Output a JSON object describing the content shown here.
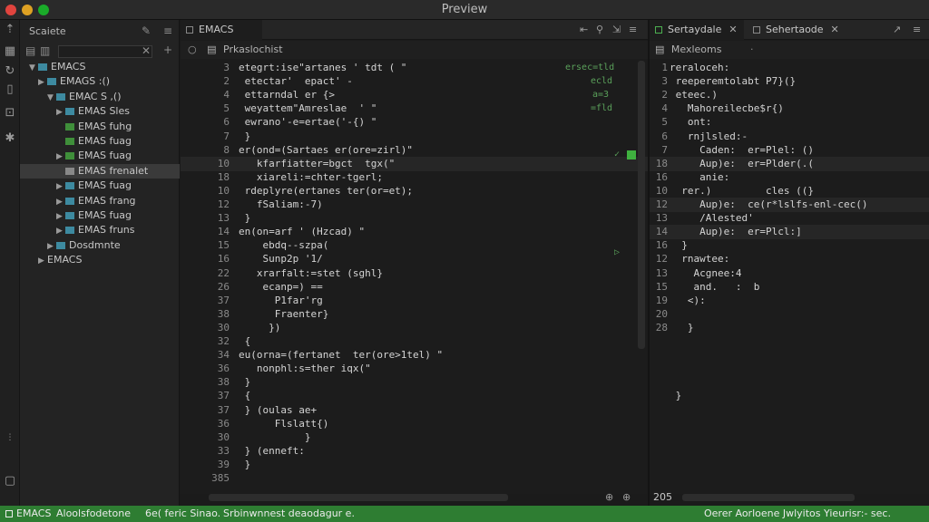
{
  "window": {
    "title": "Preview"
  },
  "colors": {
    "accent": "#2e7d32",
    "background": "#1c1c1c",
    "sidebar": "#232323"
  },
  "activity_icons": [
    "arrow-up-icon",
    "files-icon",
    "refresh-icon",
    "document-icon",
    "debug-icon",
    "settings-icon"
  ],
  "sidebar": {
    "title": "Scaiete",
    "tree": [
      {
        "label": "EMACS",
        "twisty": "▼",
        "icon": "folder",
        "indent": 0
      },
      {
        "label": "EMAGS :()",
        "twisty": "▶",
        "icon": "folder",
        "indent": 1
      },
      {
        "label": "EMAC S ,()",
        "twisty": "▼",
        "icon": "folder",
        "indent": 2
      },
      {
        "label": "EMAS Sles",
        "twisty": "▶",
        "icon": "folder",
        "indent": 3
      },
      {
        "label": "EMAS fuhg",
        "twisty": "",
        "icon": "green",
        "indent": 3
      },
      {
        "label": "EMAS fuag",
        "twisty": "",
        "icon": "green",
        "indent": 3
      },
      {
        "label": "EMAS fuag",
        "twisty": "▶",
        "icon": "green",
        "indent": 3
      },
      {
        "label": "EMAS frenalet",
        "twisty": "",
        "icon": "gray",
        "indent": 3,
        "selected": true
      },
      {
        "label": "EMAS fuag",
        "twisty": "▶",
        "icon": "folder",
        "indent": 3
      },
      {
        "label": "EMAS frang",
        "twisty": "▶",
        "icon": "folder",
        "indent": 3
      },
      {
        "label": "EMAS fuag",
        "twisty": "▶",
        "icon": "folder",
        "indent": 3
      },
      {
        "label": "EMAS fruns",
        "twisty": "▶",
        "icon": "folder",
        "indent": 3
      },
      {
        "label": "Dosdmnte",
        "twisty": "▶",
        "icon": "folder",
        "indent": 2
      },
      {
        "label": "EMACS",
        "twisty": "▶",
        "icon": "",
        "indent": 1
      }
    ]
  },
  "editor_left": {
    "tab_label": "EMACS",
    "breadcrumb": "Prkaslochist",
    "line_numbers": [
      "3",
      "2",
      "4",
      "5",
      "6",
      "7",
      "8",
      "10",
      "18",
      "10",
      "12",
      "13",
      "14",
      "15",
      "16",
      "22",
      "26",
      "37",
      "38",
      "30",
      "32",
      "34",
      "36",
      "38",
      "37",
      "37",
      "36",
      "30",
      "33",
      "39",
      "385"
    ],
    "lines": [
      "etegrt:ise\"artanes ' tdt ( \"",
      " etectar'  epact' -",
      " ettarndal er {>",
      " weyattem\"Amreslae  ' \"",
      " ewrano'-e=ertae('-{) \"",
      " }",
      "er(ond=(Sartaes er(ore=zirl)\"",
      "   kfarfiatter=bgct  tgx(\"",
      "   xiareli:=chter-tgerl;",
      " rdeplyre(ertanes ter(or=et);",
      "   fSaliam:-7)",
      " }",
      "en(on=arf ' (Hzcad) \"",
      "    ebdq--szpa(",
      "    Sunp2p '1/",
      "   xrarfalt:=stet (sghl}",
      "    ecanp=) ==",
      "      P1far'rg",
      "      Fraenter}",
      "     })",
      " {",
      "eu(orna=(fertanet  ter(ore>1tel) \"",
      "   nonphl:s=ther iqx(\"",
      " }",
      " {",
      " } (oulas ae+",
      "      Flslatt{)",
      "           }",
      " } (enneft:",
      " }",
      ""
    ],
    "markers": [
      "ersec=tld",
      "ecld",
      "a=3",
      "=fld"
    ],
    "status_right": "⊕ ⊕"
  },
  "editor_right": {
    "tabs": [
      {
        "label": "Sertaydale"
      },
      {
        "label": "Sehertaode"
      }
    ],
    "breadcrumb": "Mexleoms",
    "line_numbers": [
      "1",
      "3",
      "2",
      "4",
      "5",
      "6",
      "7",
      "18",
      "16",
      "10",
      "12",
      "13",
      "14",
      "16",
      "12",
      "13",
      "15",
      "19",
      "20",
      "28",
      "",
      "",
      " ",
      "",
      ""
    ],
    "lines": [
      "reraloceh:",
      " reeperemtolabt P7}(}",
      " eteec.)",
      "   Mahoreilecbe$r{)",
      "   ont:",
      "   rnjlsled:-",
      "     Caden:  er=Plel: ()",
      "     Aup)e:  er=Plder(.(",
      "     anie:",
      "  rer.)         cles ((}",
      "     Aup)e:  ce(r*lslfs-enl-cec()",
      "     /Alested'",
      "     Aup)e:  er=Plcl:]",
      "  }",
      "  rnawtee:",
      "    Acgnee:4",
      "    and.   :  b",
      "   <):",
      "",
      "   }",
      "",
      "",
      "",
      "",
      " }"
    ],
    "bottom_number": "205"
  },
  "statusbar": {
    "left": "EMACS",
    "item2": "Aloolsfodetone",
    "item3": "6e(  feric  Sinao.",
    "item4": "Srbinwnnest deaodagur e.",
    "right": "Oerer Aorloene Jwlyitos Yieurisr:- sec."
  }
}
